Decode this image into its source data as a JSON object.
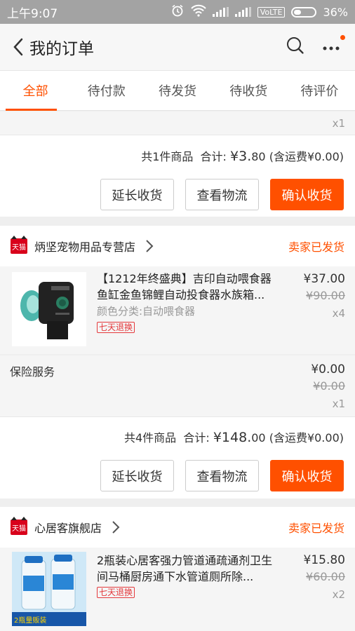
{
  "status_bar": {
    "time": "上午9:07",
    "network": "VoLTE",
    "battery": "36%"
  },
  "header": {
    "title": "我的订单"
  },
  "tabs": [
    {
      "label": "全部"
    },
    {
      "label": "待付款"
    },
    {
      "label": "待发货"
    },
    {
      "label": "待收货"
    },
    {
      "label": "待评价"
    }
  ],
  "order0": {
    "qty": "x1",
    "summary_count": "共1件商品",
    "summary_total_label": "合计: ",
    "summary_total_int": "¥3.",
    "summary_total_dec": "80",
    "summary_shipping": "(含运费¥0.00)",
    "btn_extend": "延长收货",
    "btn_logistics": "查看物流",
    "btn_confirm": "确认收货"
  },
  "order1": {
    "badge": "天猫",
    "shop": "炳坚宠物用品专营店",
    "status": "卖家已发货",
    "title": "【1212年终盛典】吉印自动喂食器鱼缸金鱼锦鲤自动投食器水族箱...",
    "spec": "颜色分类:自动喂食器",
    "tag": "七天退换",
    "price": "¥37.00",
    "orig_price": "¥90.00",
    "qty": "x4",
    "insurance_label": "保险服务",
    "ins_price": "¥0.00",
    "ins_orig": "¥0.00",
    "ins_qty": "x1",
    "summary_count": "共4件商品",
    "summary_total_label": "合计: ",
    "summary_total_int": "¥148.",
    "summary_total_dec": "00",
    "summary_shipping": "(含运费¥0.00)",
    "btn_extend": "延长收货",
    "btn_logistics": "查看物流",
    "btn_confirm": "确认收货"
  },
  "order2": {
    "badge": "天猫",
    "shop": "心居客旗舰店",
    "status": "卖家已发货",
    "title": "2瓶装心居客强力管道通疏通剂卫生间马桶厨房通下水管道厕所除...",
    "tag": "七天退换",
    "price": "¥15.80",
    "orig_price": "¥60.00",
    "qty": "x2",
    "thumb_caption": "2瓶量贩装"
  },
  "colors": {
    "accent": "#ff5000",
    "tag": "#e4393c",
    "tmall": "#d8001b"
  }
}
